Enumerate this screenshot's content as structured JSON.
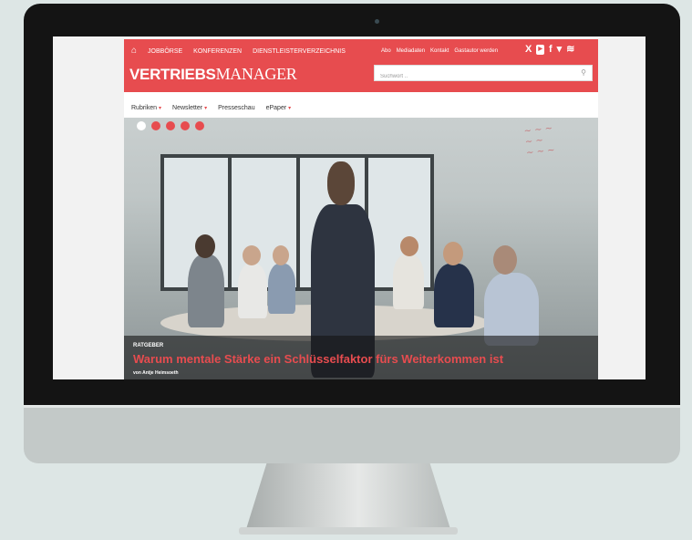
{
  "topnav": [
    "JOBBÖRSE",
    "KONFERENZEN",
    "DIENSTLEISTERVERZEICHNIS"
  ],
  "toplinks": [
    "Abo",
    "Mediadaten",
    "Kontakt",
    "Gastautor werden"
  ],
  "icons": {
    "home": "home-icon",
    "social": [
      "xing-icon",
      "youtube-icon",
      "facebook-icon",
      "twitter-icon",
      "rss-icon"
    ],
    "search": "search-icon"
  },
  "logo": {
    "bold": "VERTRIEBS",
    "light": "MANAGER"
  },
  "search": {
    "placeholder": "Suchwort ..",
    "value": ""
  },
  "mainnav": [
    {
      "label": "Rubriken",
      "dropdown": true
    },
    {
      "label": "Newsletter",
      "dropdown": true
    },
    {
      "label": "Presseschau",
      "dropdown": false
    },
    {
      "label": "ePaper",
      "dropdown": true
    }
  ],
  "slider": {
    "count": 5,
    "active": 0
  },
  "article": {
    "category": "RATGEBER",
    "headline": "Warum mentale Stärke ein Schlüsselfaktor fürs Weiterkommen ist",
    "author": "von Antje Heimsoeth"
  },
  "colors": {
    "accent": "#e74c4f",
    "bezel": "#141414",
    "background": "#dde6e5"
  }
}
